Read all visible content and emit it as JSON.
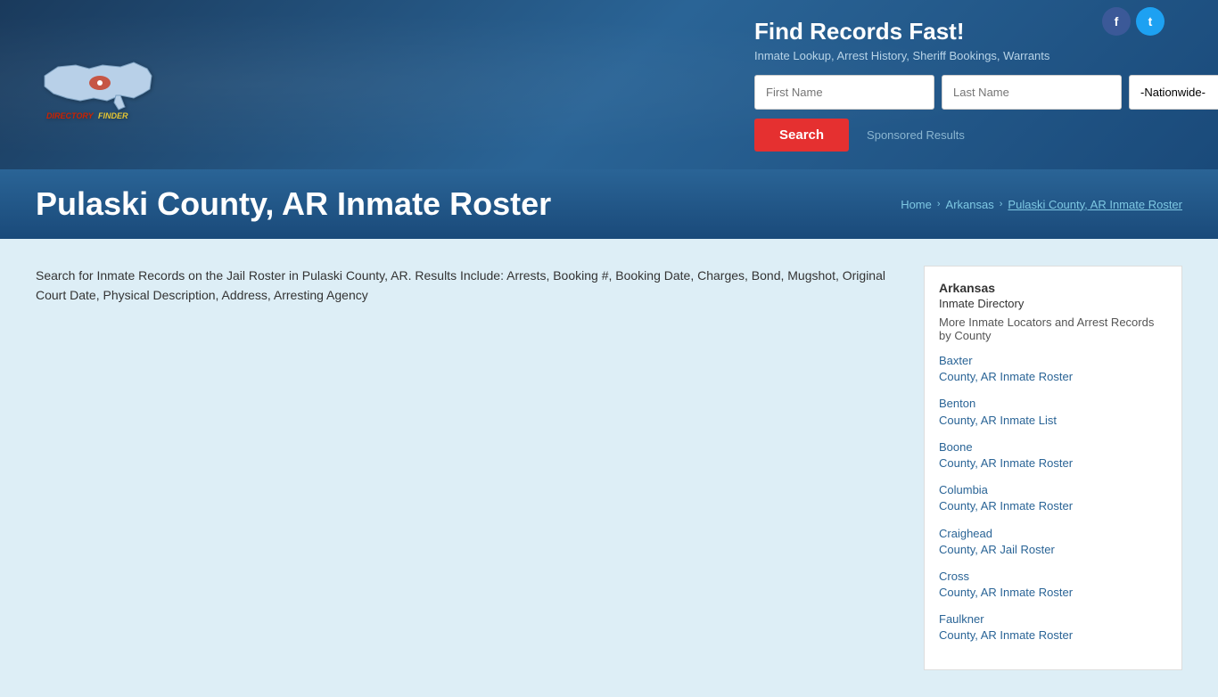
{
  "social": {
    "facebook_label": "f",
    "twitter_label": "t"
  },
  "header": {
    "logo_text_directory": "Directory",
    "logo_text_finder": "Finder",
    "title": "Find Records Fast!",
    "subtitle": "Inmate Lookup, Arrest History, Sheriff Bookings, Warrants",
    "first_name_placeholder": "First Name",
    "last_name_placeholder": "Last Name",
    "nationwide_default": "-Nationwide-",
    "search_button": "Search",
    "sponsored_label": "Sponsored Results"
  },
  "title_bar": {
    "page_title": "Pulaski County, AR Inmate Roster",
    "breadcrumb": {
      "home": "Home",
      "state": "Arkansas",
      "current": "Pulaski County, AR Inmate Roster"
    }
  },
  "main": {
    "description": "Search for Inmate Records on the Jail Roster in Pulaski County, AR. Results Include: Arrests, Booking #, Booking Date, Charges, Bond, Mugshot, Original Court Date, Physical Description, Address, Arresting Agency"
  },
  "sidebar": {
    "state_title": "Arkansas",
    "directory_subtitle": "Inmate Directory",
    "more_title": "More Inmate Locators and Arrest Records by County",
    "links": [
      {
        "label": "Baxter County, AR Inmate Roster",
        "href": "#"
      },
      {
        "label": "Benton County, AR Inmate List",
        "href": "#"
      },
      {
        "label": "Boone County, AR Inmate Roster",
        "href": "#"
      },
      {
        "label": "Columbia County, AR Inmate Roster",
        "href": "#"
      },
      {
        "label": "Craighead County, AR Jail Roster",
        "href": "#"
      },
      {
        "label": "Cross County, AR Inmate Roster",
        "href": "#"
      },
      {
        "label": "Faulkner County, AR Inmate Roster",
        "href": "#"
      }
    ]
  }
}
